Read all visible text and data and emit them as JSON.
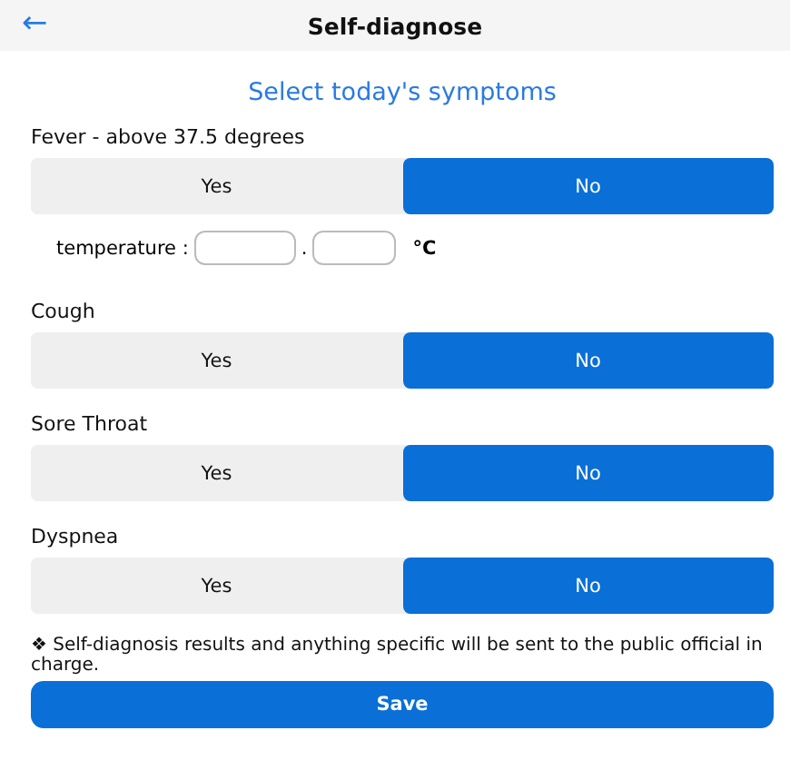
{
  "header": {
    "back_icon": "←",
    "title": "Self-diagnose"
  },
  "heading": "Select today's symptoms",
  "symptoms": [
    {
      "label": "Fever - above 37.5 degrees",
      "options": [
        {
          "label": "Yes",
          "selected": false
        },
        {
          "label": "No",
          "selected": true
        }
      ],
      "temperature": {
        "label": "temperature :",
        "separator": ".",
        "unit": "°C"
      }
    },
    {
      "label": "Cough",
      "options": [
        {
          "label": "Yes",
          "selected": false
        },
        {
          "label": "No",
          "selected": true
        }
      ]
    },
    {
      "label": "Sore Throat",
      "options": [
        {
          "label": "Yes",
          "selected": false
        },
        {
          "label": "No",
          "selected": true
        }
      ]
    },
    {
      "label": "Dyspnea",
      "options": [
        {
          "label": "Yes",
          "selected": false
        },
        {
          "label": "No",
          "selected": true
        }
      ]
    }
  ],
  "note": "❖ Self-diagnosis results and anything specific will be sent to the public official in charge.",
  "save_button": "Save"
}
